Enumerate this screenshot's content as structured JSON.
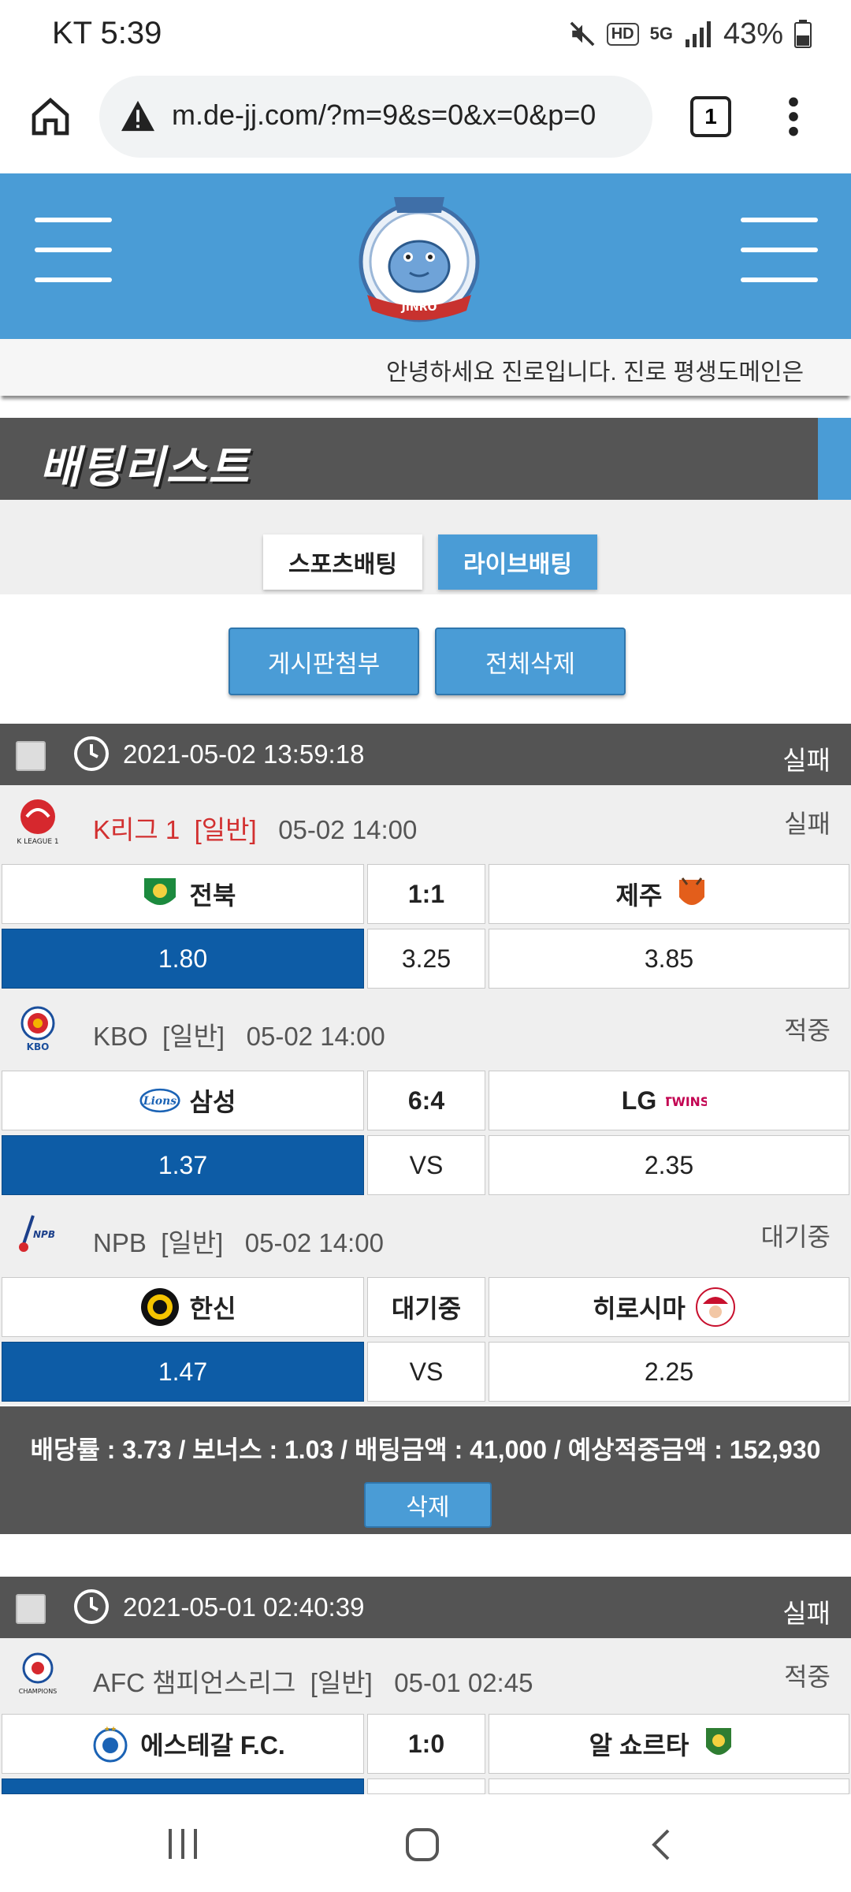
{
  "status_bar": {
    "carrier_time": "KT 5:39",
    "hd_label": "HD",
    "network_label": "5G",
    "battery": "43%"
  },
  "browser": {
    "url": "m.de-jj.com/?m=9&s=0&x=0&p=0",
    "tab_count": "1"
  },
  "header": {
    "logo_text": "JINRO"
  },
  "marquee_text": "안녕하세요 진로입니다. 진로 평생도메인은",
  "page_title": "배팅리스트",
  "tabs": [
    {
      "label": "스포츠배팅",
      "active": false
    },
    {
      "label": "라이브배팅",
      "active": true
    }
  ],
  "actions": {
    "attach_label": "게시판첨부",
    "delete_all_label": "전체삭제"
  },
  "bets": [
    {
      "datetime": "2021-05-02 13:59:18",
      "result": "실패",
      "games": [
        {
          "league": "K리그 1",
          "league_type": "[일반]",
          "kickoff": "05-02 14:00",
          "status": "실패",
          "home": "전북",
          "score": "1:1",
          "away": "제주",
          "odds_home": "1.80",
          "odds_mid": "3.25",
          "odds_away": "3.85"
        },
        {
          "league": "KBO",
          "league_type": "[일반]",
          "kickoff": "05-02 14:00",
          "status": "적중",
          "home": "삼성",
          "score": "6:4",
          "away": "LG",
          "odds_home": "1.37",
          "odds_mid": "VS",
          "odds_away": "2.35"
        },
        {
          "league": "NPB",
          "league_type": "[일반]",
          "kickoff": "05-02 14:00",
          "status": "대기중",
          "home": "한신",
          "score": "대기중",
          "away": "히로시마",
          "odds_home": "1.47",
          "odds_mid": "VS",
          "odds_away": "2.25"
        }
      ],
      "summary": "배당률 : 3.73 / 보너스 : 1.03 / 배팅금액 : 41,000 / 예상적중금액 : 152,930",
      "delete_label": "삭제"
    },
    {
      "datetime": "2021-05-01 02:40:39",
      "result": "실패",
      "games": [
        {
          "league": "AFC 챔피언스리그",
          "league_type": "[일반]",
          "kickoff": "05-01 02:45",
          "status": "적중",
          "home": "에스테갈 F.C.",
          "score": "1:0",
          "away": "알 쇼르타"
        }
      ]
    }
  ],
  "colors": {
    "brand_blue": "#4a9cd6",
    "selected_odds": "#0d5ca6",
    "dark_band": "#555555",
    "league_red": "#d23030"
  }
}
